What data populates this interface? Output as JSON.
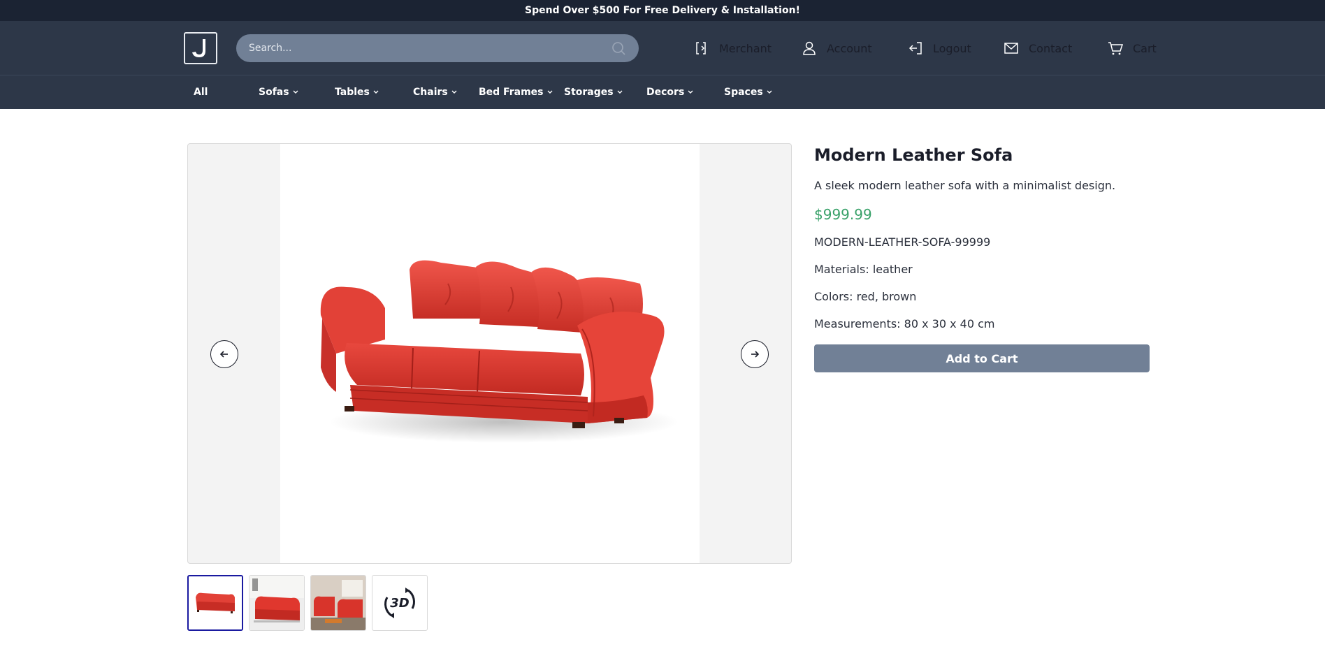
{
  "promo": {
    "text": "Spend Over $500 For Free Delivery & Installation!"
  },
  "search": {
    "placeholder": "Search..."
  },
  "header_links": {
    "merchant": "Merchant",
    "account": "Account",
    "logout": "Logout",
    "contact": "Contact",
    "cart": "Cart"
  },
  "categories": [
    "All",
    "Sofas",
    "Tables",
    "Chairs",
    "Bed Frames",
    "Storages",
    "Decors",
    "Spaces"
  ],
  "product": {
    "title": "Modern Leather Sofa",
    "description": "A sleek modern leather sofa with a minimalist design.",
    "price": "$999.99",
    "sku": "MODERN-LEATHER-SOFA-99999",
    "materials": "Materials: leather",
    "colors": "Colors: red, brown",
    "measurements": "Measurements: 80 x 30 x 40 cm",
    "add_to_cart": "Add to Cart"
  },
  "thumbnail_3d_label": "3D",
  "colors": {
    "accent_price": "#38a169",
    "header_bg": "#2d3748",
    "promo_bg": "#1b2333",
    "button_bg": "#718096",
    "thumb_active": "#1a1aa0",
    "sofa_red": "#d9342b"
  },
  "icons": {
    "search": "search-icon",
    "merchant": "merchant-icon",
    "account": "user-icon",
    "logout": "logout-icon",
    "contact": "mail-icon",
    "cart": "cart-icon",
    "prev": "arrow-left-icon",
    "next": "arrow-right-icon",
    "chevron": "chevron-down-icon"
  }
}
